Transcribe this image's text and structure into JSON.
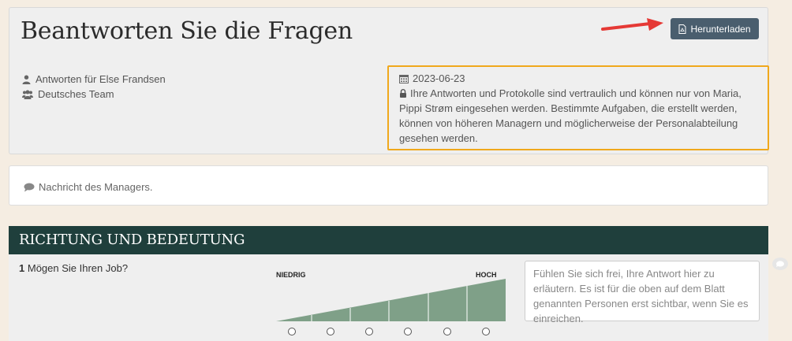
{
  "header": {
    "title": "Beantworten Sie die Fragen",
    "download_label": "Herunterladen"
  },
  "meta": {
    "answers_for": "Antworten für Else Frandsen",
    "team": "Deutsches Team",
    "date": "2023-06-23",
    "privacy": "Ihre Antworten und Protokolle sind vertraulich und können nur von Maria, Pippi Strøm eingesehen werden. Bestimmte Aufgaben, die erstellt werden, können von höheren Managern und möglicherweise der Personalabteilung gesehen werden."
  },
  "manager_message": {
    "label": "Nachricht des Managers."
  },
  "section": {
    "title": "RICHTUNG UND BEDEUTUNG",
    "questions": [
      {
        "number": "1",
        "text": "Mögen Sie Ihren Job?",
        "scale_low": "NIEDRIG",
        "scale_high": "HOCH",
        "options": 6,
        "comment_placeholder": "Fühlen Sie sich frei, Ihre Antwort hier zu erläutern. Es ist für die oben auf dem Blatt genannten Personen erst sichtbar, wenn Sie es einreichen."
      }
    ]
  },
  "colors": {
    "background": "#f5ede2",
    "button": "#4a5e6e",
    "highlight": "#f0a81c",
    "section_header": "#1f3f3c",
    "scale_fill": "#7fa088",
    "arrow": "#e53935"
  },
  "icons": {
    "download": "pdf-file-icon",
    "user": "user-icon",
    "team": "users-icon",
    "date": "calendar-icon",
    "privacy": "lock-icon",
    "message": "comment-icon"
  }
}
